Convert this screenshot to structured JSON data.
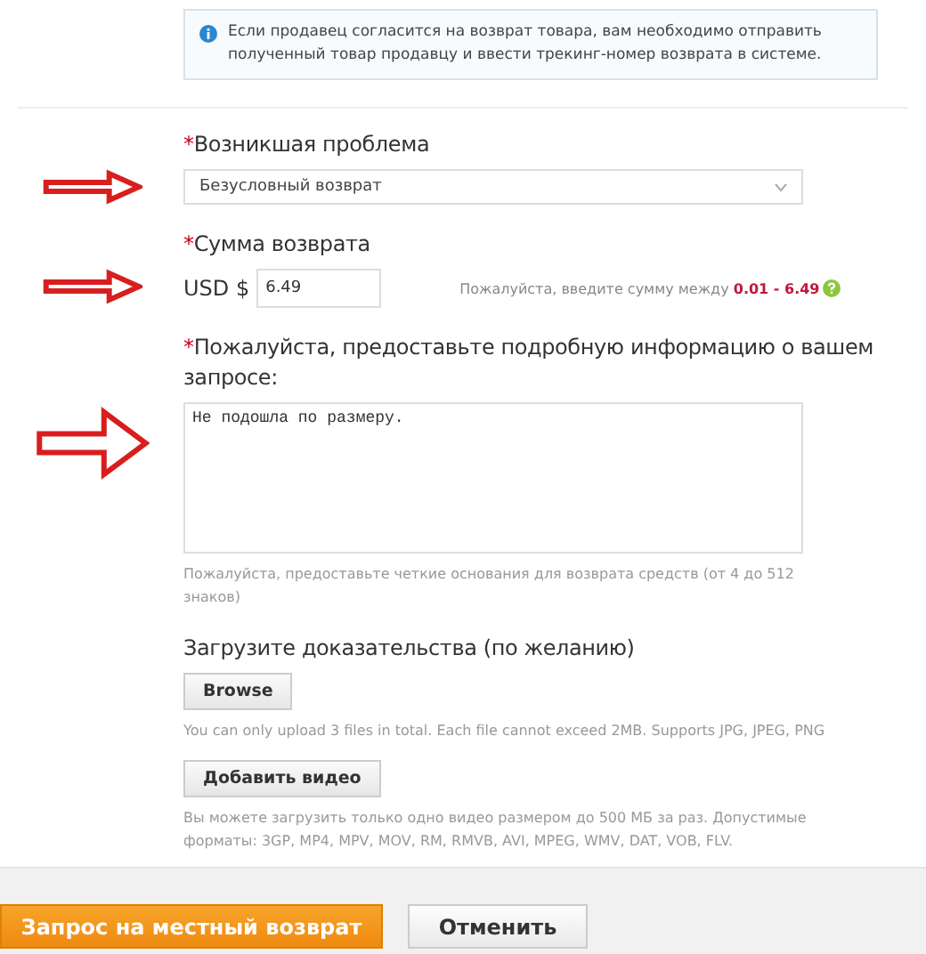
{
  "notice": {
    "text": "Если продавец согласится на возврат товара, вам необходимо отправить полученный товар продавцу и ввести трекинг-номер возврата в системе."
  },
  "problem": {
    "mark": "*",
    "label": "Возникшая проблема",
    "value": "Безусловный возврат"
  },
  "amount": {
    "mark": "*",
    "label": "Сумма возврата",
    "currency": "USD $",
    "value": "6.49",
    "hint": "Пожалуйста, введите сумму между **0.01 - 6.49**"
  },
  "details": {
    "mark": "*",
    "label": "Пожалуйста, предоставьте подробную информацию о вашем запросе:",
    "value": "Не подошла по размеру.",
    "hint": "Пожалуйста, предоставьте четкие основания для возврата средств (от 4 до 512 знаков)"
  },
  "upload": {
    "label": "Загрузите доказательства (по желанию)",
    "browse": "Browse",
    "browse_note": "You can only upload 3 files in total. Each file cannot exceed 2MB. Supports JPG, JPEG, PNG",
    "video": "Добавить видео",
    "video_note": "Вы можете загрузить только одно видео размером до 500 МБ за раз. Допустимые форматы: 3GP, MP4, MPV, MOV, RM, RMVB, AVI, MPEG, WMV, DAT, VOB, FLV."
  },
  "buttons": [
    {
      "kind": "primary",
      "label": "Запрос на местный возврат"
    },
    {
      "kind": "secondary",
      "label": "Отменить"
    }
  ]
}
